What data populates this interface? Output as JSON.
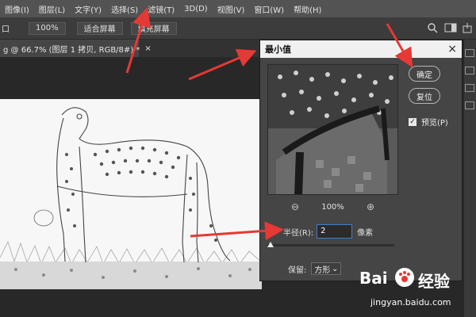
{
  "menubar": {
    "items": [
      "图像(I)",
      "图层(L)",
      "文字(Y)",
      "选择(S)",
      "滤镜(T)",
      "3D(D)",
      "视图(V)",
      "窗口(W)",
      "帮助(H)"
    ]
  },
  "options": {
    "left_label": "口",
    "zoom_value": "100%",
    "fit_screen": "适合屏幕",
    "fill_screen": "填充屏幕"
  },
  "document_tab": {
    "title": "g @ 66.7% (图层 1 拷贝, RGB/8#) *",
    "close": "×"
  },
  "dialog": {
    "title": "最小值",
    "close": "×",
    "ok": "确定",
    "reset": "复位",
    "preview_label": "预览(P)",
    "preview_checked": true,
    "zoom_out": "⊖",
    "zoom_level": "100%",
    "zoom_in": "⊕",
    "radius_label": "半径(R):",
    "radius_value": "2",
    "radius_unit": "像素",
    "preserve_label": "保留:",
    "preserve_value": "方形"
  },
  "watermark": {
    "logo_prefix": "Bai",
    "logo_suffix": "经验",
    "url": "jingyan.baidu.com"
  },
  "colors": {
    "arrow": "#e53935",
    "accent": "#3f7dd0"
  }
}
